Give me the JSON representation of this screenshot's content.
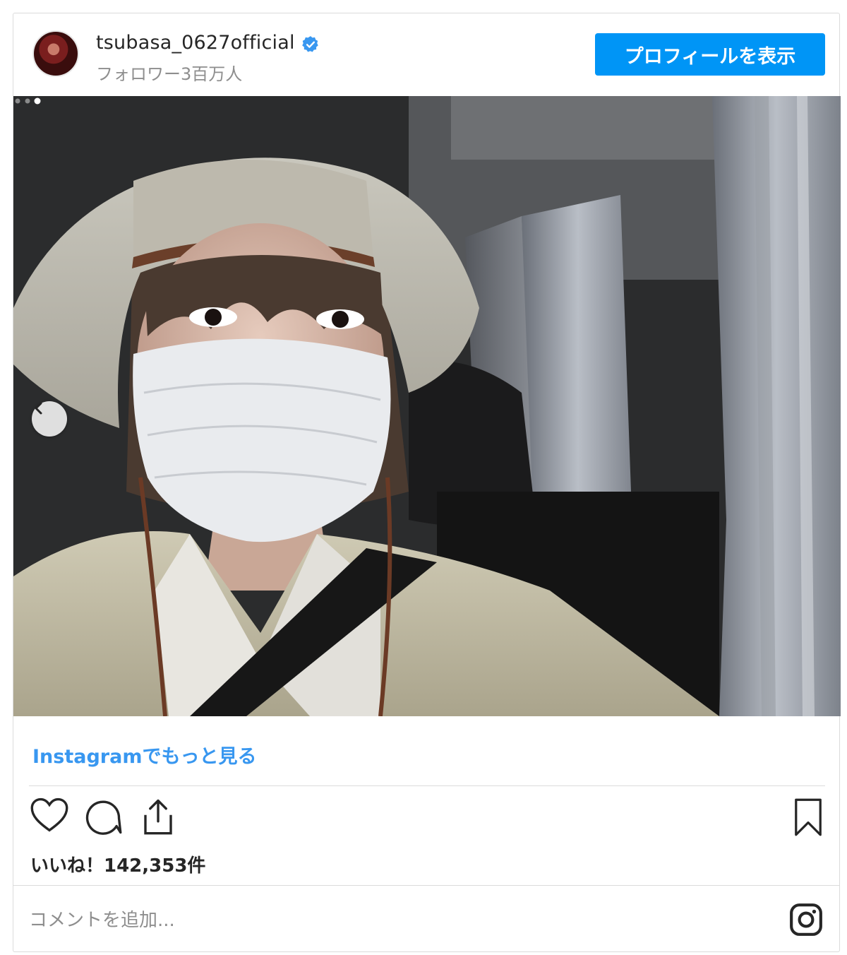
{
  "header": {
    "username": "tsubasa_0627official",
    "followers": "フォロワー3百万人",
    "profile_button": "プロフィールを表示"
  },
  "post": {
    "photo_icon": "prev-chevron-icon",
    "carousel_dots": 3,
    "active_dot": 3,
    "more_link": "Instagramでもっと見る",
    "likes": "いいね！142,353件"
  },
  "comment": {
    "placeholder": "コメントを追加..."
  },
  "colors": {
    "accent": "#0095f6",
    "link": "#3897f0",
    "text": "#262626",
    "muted": "#8e8e8e",
    "border": "#dbdbdb"
  }
}
